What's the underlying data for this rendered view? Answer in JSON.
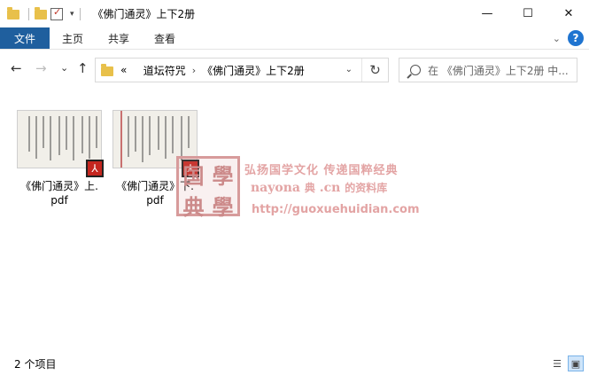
{
  "window": {
    "title": "《佛门通灵》上下2册",
    "minimize": "—",
    "maximize": "☐",
    "close": "✕"
  },
  "ribbon": {
    "tabs": [
      "文件",
      "主页",
      "共享",
      "查看"
    ],
    "help": "?"
  },
  "nav": {
    "back": "←",
    "forward": "→",
    "recent": "⌄",
    "up": "↑",
    "crumb_prefix": "«",
    "breadcrumbs": [
      "道坛符咒",
      "《佛门通灵》上下2册"
    ],
    "refresh": "↻",
    "search_placeholder": "在 《佛门通灵》上下2册 中..."
  },
  "files": [
    {
      "name": "《佛门通灵》上.\npdf",
      "type": "pdf"
    },
    {
      "name": "《佛门通灵》下.\npdf",
      "type": "pdf"
    }
  ],
  "watermark": {
    "seal_chars": [
      "国",
      "學",
      "典",
      "學"
    ],
    "line1": "弘扬国学文化  传递国粹经典",
    "line2a": "nayona",
    "line2b": "典",
    "line2c": ".cn",
    "line2d": "的资料库",
    "line3": "http://guoxuehuidian.com"
  },
  "status": {
    "count_text": "2 个项目"
  },
  "colors": {
    "file_tab_bg": "#1f5f9e",
    "help_bg": "#1f74d0",
    "pdf_red": "#c5261f",
    "folder_yellow": "#e8c04a",
    "watermark": "#e3a4a4"
  }
}
